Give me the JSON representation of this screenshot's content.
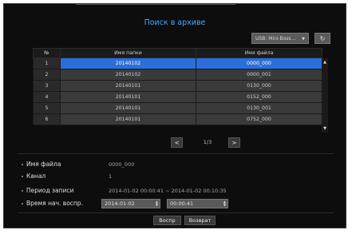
{
  "dialog": {
    "title": "Поиск в архиве",
    "device_select": {
      "value": "USB: Mini-Boss...",
      "arrow": "▼"
    },
    "refresh_icon": "refresh-icon"
  },
  "table": {
    "headers": [
      "№",
      "Имя папки",
      "Имя файла"
    ],
    "rows": [
      {
        "num": "1",
        "folder": "20140102",
        "file": "0000_000",
        "selected": true
      },
      {
        "num": "2",
        "folder": "20140102",
        "file": "0000_001",
        "selected": false
      },
      {
        "num": "3",
        "folder": "20140101",
        "file": "0130_000",
        "selected": false
      },
      {
        "num": "4",
        "folder": "20140101",
        "file": "0152_000",
        "selected": false
      },
      {
        "num": "5",
        "folder": "20140101",
        "file": "0130_001",
        "selected": false
      },
      {
        "num": "6",
        "folder": "20140101",
        "file": "0752_000",
        "selected": false
      }
    ]
  },
  "pagination": {
    "prev": "<",
    "next": ">",
    "text": "1/3"
  },
  "details": {
    "file_name_label": "Имя файла",
    "file_name_value": "0000_000",
    "channel_label": "Канал",
    "channel_value": "1",
    "period_label": "Период записи",
    "period_value": "2014-01-02 00:00:41 ~ 2014-01-02 00:10:35",
    "start_time_label": "Время нач. воспр.",
    "start_date_value": "2014-01-02",
    "start_time_value": "00:00:41"
  },
  "buttons": {
    "play": "Воспр",
    "back": "Возврат"
  },
  "colors": {
    "accent": "#2a6fdc",
    "title": "#4fa3ff",
    "background": "#0d0d0d"
  }
}
